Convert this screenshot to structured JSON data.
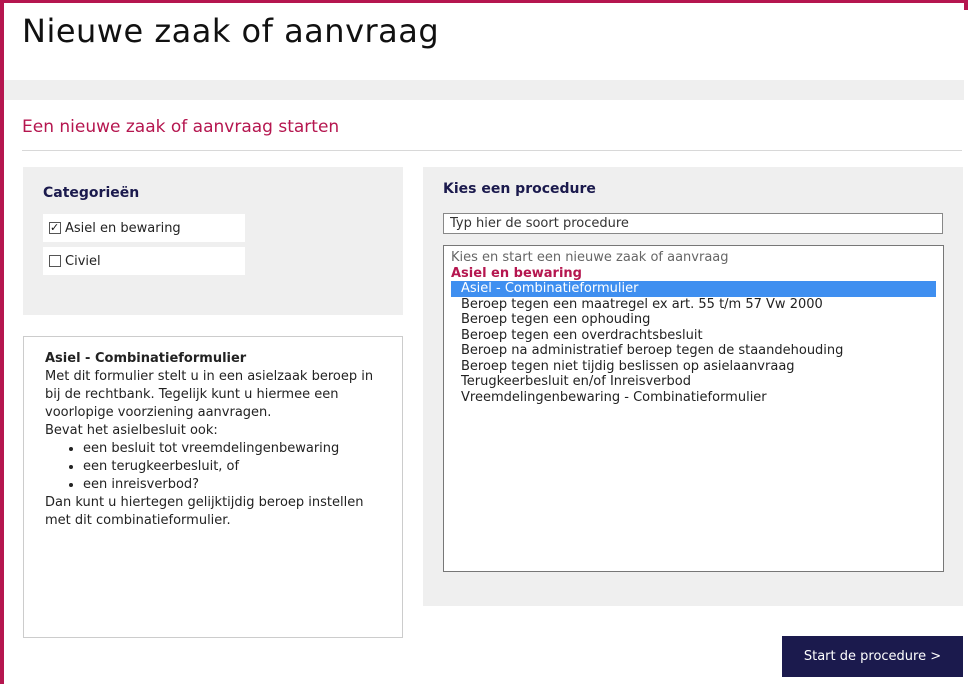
{
  "page": {
    "title": "Nieuwe zaak of aanvraag",
    "section_title": "Een nieuwe zaak of aanvraag starten"
  },
  "categories": {
    "heading": "Categorieën",
    "items": [
      {
        "label": "Asiel en bewaring",
        "checked": true
      },
      {
        "label": "Civiel",
        "checked": false
      }
    ]
  },
  "procedure": {
    "heading": "Kies een procedure",
    "search_placeholder": "Typ hier de soort procedure",
    "list_hint": "Kies en start een nieuwe zaak of aanvraag",
    "group_label": "Asiel en bewaring",
    "options": [
      {
        "label": "Asiel - Combinatieformulier",
        "selected": true
      },
      {
        "label": "Beroep tegen een maatregel ex art. 55 t/m 57 Vw 2000",
        "selected": false
      },
      {
        "label": "Beroep tegen een ophouding",
        "selected": false
      },
      {
        "label": "Beroep tegen een overdrachtsbesluit",
        "selected": false
      },
      {
        "label": "Beroep na administratief beroep tegen de staandehouding",
        "selected": false
      },
      {
        "label": "Beroep tegen niet tijdig beslissen op asielaanvraag",
        "selected": false
      },
      {
        "label": "Terugkeerbesluit en/of Inreisverbod",
        "selected": false
      },
      {
        "label": "Vreemdelingenbewaring - Combinatieformulier",
        "selected": false
      }
    ]
  },
  "description": {
    "title": "Asiel - Combinatieformulier",
    "intro": "Met dit formulier stelt u in een asielzaak beroep in bij de rechtbank. Tegelijk kunt u hiermee een voorlopige voorziening aanvragen.",
    "question": "Bevat het asielbesluit ook:",
    "bullets": [
      "een besluit tot vreemdelingenbewaring",
      "een terugkeerbesluit, of",
      "een inreisverbod?"
    ],
    "outro": "Dan kunt u hiertegen gelijktijdig beroep instellen met dit combinatieformulier."
  },
  "actions": {
    "start_label": "Start de procedure >"
  },
  "colors": {
    "accent": "#b5164f",
    "navy": "#1b1a4d",
    "selection": "#3f8ff0",
    "panel_bg": "#efefef"
  }
}
